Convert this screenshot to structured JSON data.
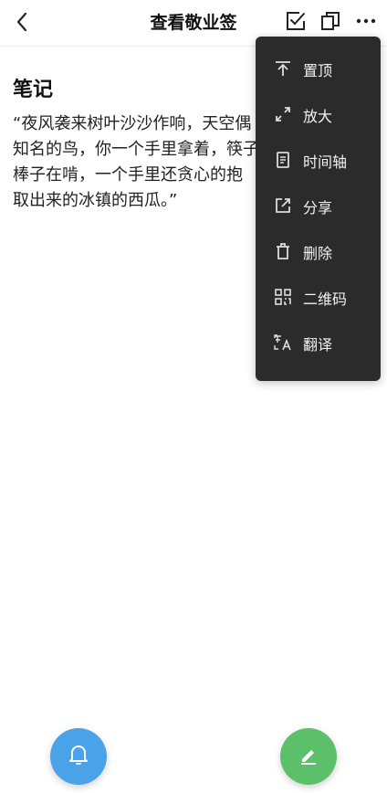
{
  "header": {
    "title": "查看敬业签"
  },
  "note": {
    "heading": "笔记",
    "line1": "“夜风袭来树叶沙沙作响，天空偶",
    "line2": "知名的鸟，你一个手里拿着，筷子",
    "line3": "棒子在啃，一个手里还贪心的抱",
    "line4": "取出来的冰镇的西瓜。”"
  },
  "menu": {
    "items": [
      {
        "label": "置顶",
        "icon": "pin-top-icon"
      },
      {
        "label": "放大",
        "icon": "expand-icon"
      },
      {
        "label": "时间轴",
        "icon": "timeline-icon"
      },
      {
        "label": "分享",
        "icon": "share-icon"
      },
      {
        "label": "删除",
        "icon": "trash-icon"
      },
      {
        "label": "二维码",
        "icon": "qrcode-icon"
      },
      {
        "label": "翻译",
        "icon": "translate-icon"
      }
    ]
  },
  "colors": {
    "menu_bg": "#2b2b2b",
    "bell_fab": "#4aa3e8",
    "edit_fab": "#5cbf6a"
  }
}
